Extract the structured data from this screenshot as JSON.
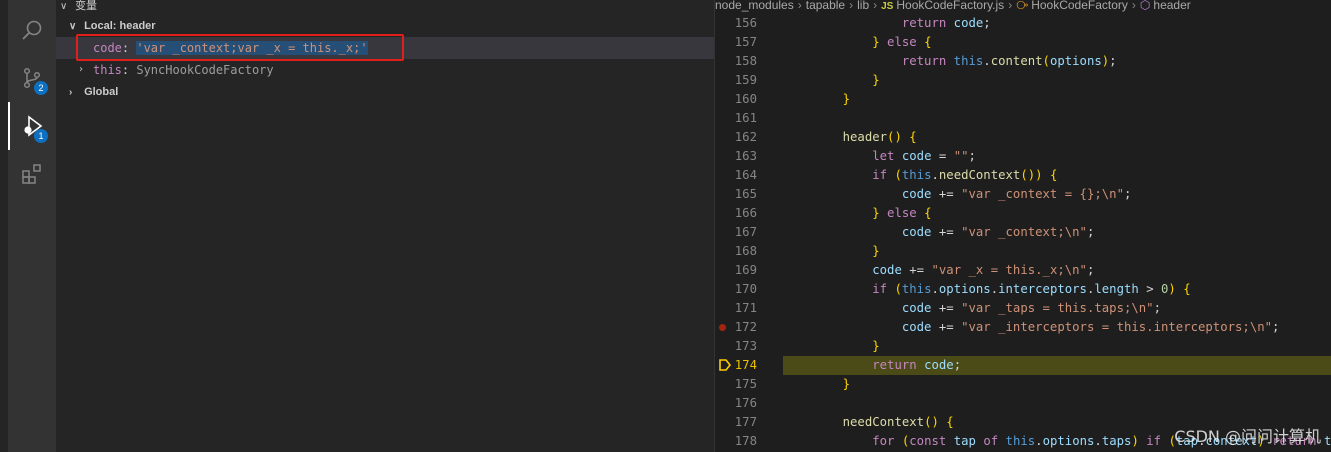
{
  "sidebar": {
    "section_title": "变量",
    "scope_local": "Local: header",
    "vars": [
      {
        "name": "code",
        "sep": ": ",
        "value": "'var _context;var _x = this._x;'"
      },
      {
        "name": "this",
        "sep": ": ",
        "value": "SyncHookCodeFactory"
      }
    ],
    "scope_global": "Global"
  },
  "activity": {
    "items": [
      {
        "icon": "search-icon"
      },
      {
        "icon": "source-control-icon",
        "badge": "2"
      },
      {
        "icon": "run-debug-icon",
        "badge": "1"
      },
      {
        "icon": "extensions-icon"
      }
    ]
  },
  "breadcrumbs": {
    "parts": [
      "node_modules",
      "tapable",
      "lib"
    ],
    "file_badge": "JS",
    "file": "HookCodeFactory.js",
    "class": "HookCodeFactory",
    "method": "header"
  },
  "editor": {
    "lines": [
      {
        "num": "156",
        "code": "            return code;"
      },
      {
        "num": "157",
        "code": "        } else {"
      },
      {
        "num": "158",
        "code": "            return this.content(options);"
      },
      {
        "num": "159",
        "code": "        }"
      },
      {
        "num": "160",
        "code": "    }"
      },
      {
        "num": "161",
        "code": ""
      },
      {
        "num": "162",
        "code": "    header() {"
      },
      {
        "num": "163",
        "code": "        let code = \"\";"
      },
      {
        "num": "164",
        "code": "        if (this.needContext()) {"
      },
      {
        "num": "165",
        "code": "            code += \"var _context = {};\\n\";"
      },
      {
        "num": "166",
        "code": "        } else {"
      },
      {
        "num": "167",
        "code": "            code += \"var _context;\\n\";"
      },
      {
        "num": "168",
        "code": "        }"
      },
      {
        "num": "169",
        "code": "        code += \"var _x = this._x;\\n\";"
      },
      {
        "num": "170",
        "code": "        if (this.options.interceptors.length > 0) {"
      },
      {
        "num": "171",
        "code": "            code += \"var _taps = this.taps;\\n\";"
      },
      {
        "num": "172",
        "code": "            code += \"var _interceptors = this.interceptors;\\n\";"
      },
      {
        "num": "173",
        "code": "        }"
      },
      {
        "num": "174",
        "code": "        return code;"
      },
      {
        "num": "175",
        "code": "    }"
      },
      {
        "num": "176",
        "code": ""
      },
      {
        "num": "177",
        "code": "    needContext() {"
      },
      {
        "num": "178",
        "code": "        for (const tap of this.options.taps) if (tap.context) return tru"
      }
    ],
    "current_line": "174",
    "breakpoint_line": "172"
  },
  "watermark": "CSDN @问问计算机",
  "colors": {
    "highlight_box": "#e0211b",
    "current_line_bg": "#4b4b18",
    "badge": "#0e70c0"
  }
}
